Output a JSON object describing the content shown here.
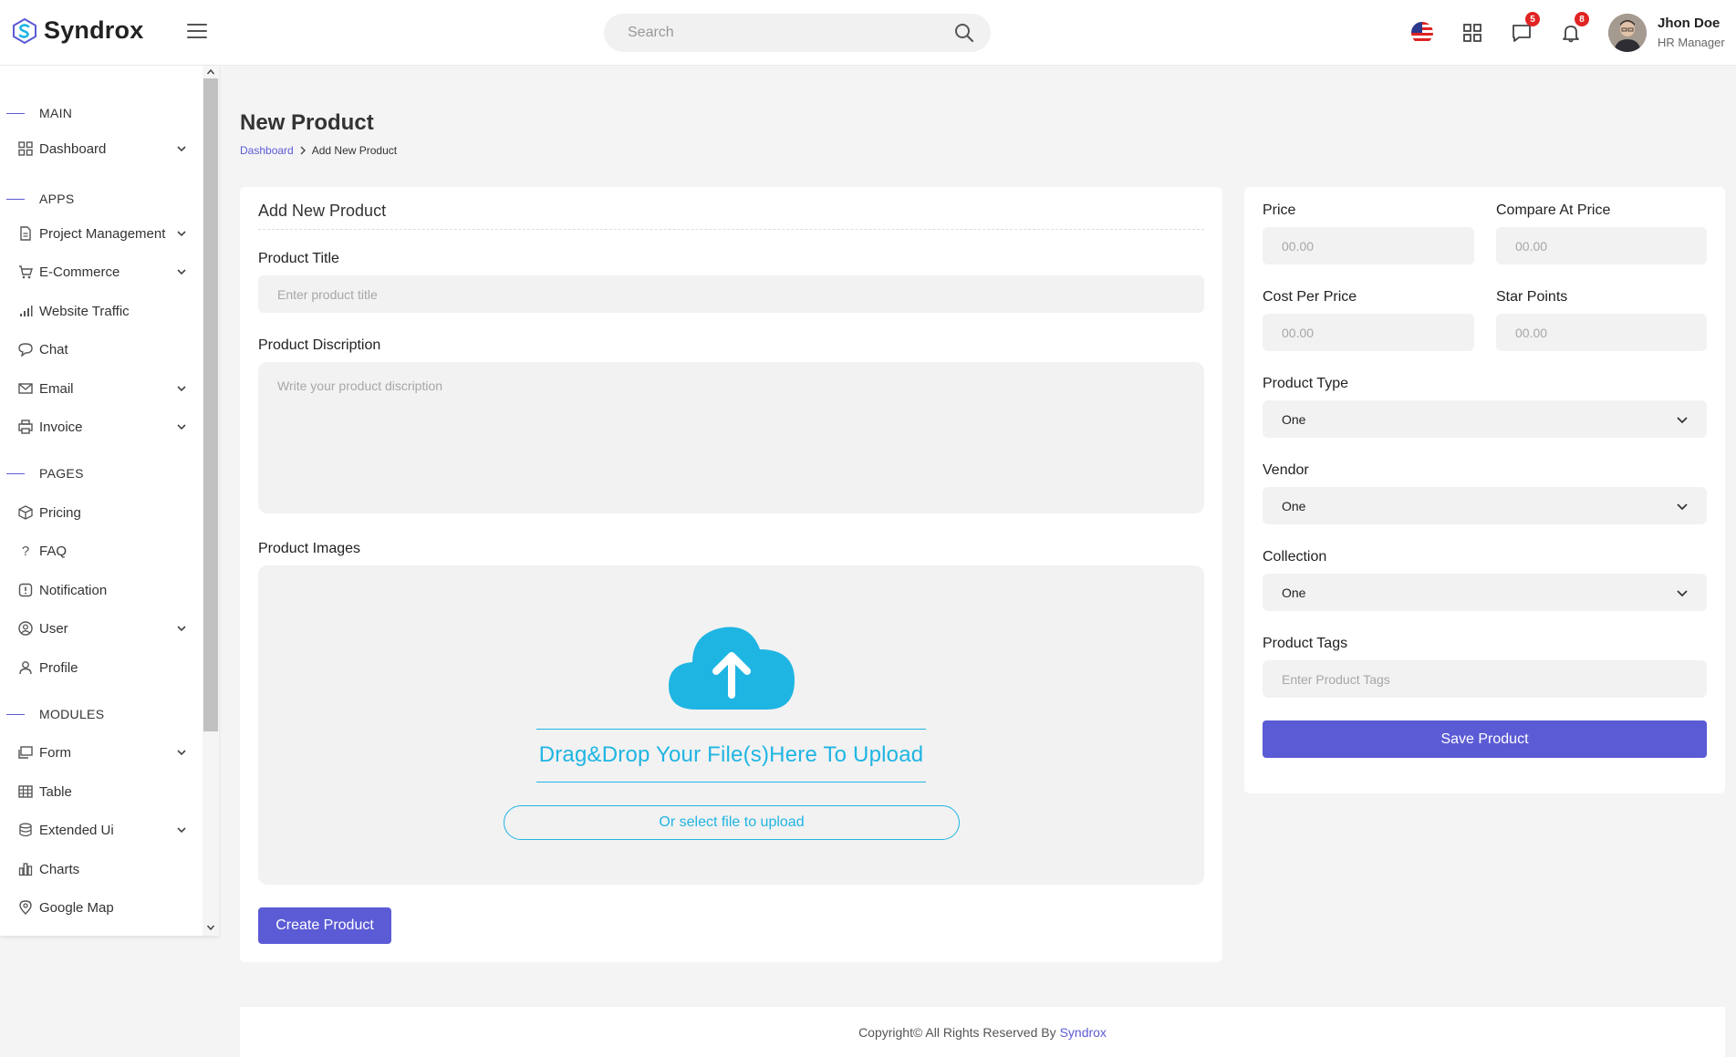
{
  "header": {
    "brand": "Syndrox",
    "search_placeholder": "Search",
    "messages_count": "5",
    "notifications_count": "8",
    "user_name": "Jhon Doe",
    "user_role": "HR Manager"
  },
  "sidebar": {
    "sections": {
      "main": "MAIN",
      "apps": "APPS",
      "pages": "PAGES",
      "modules": "MODULES"
    },
    "items": {
      "dashboard": "Dashboard",
      "project_management": "Project Management",
      "ecommerce": "E-Commerce",
      "website_traffic": "Website Traffic",
      "chat": "Chat",
      "email": "Email",
      "invoice": "Invoice",
      "pricing": "Pricing",
      "faq": "FAQ",
      "notification": "Notification",
      "user": "User",
      "profile": "Profile",
      "form": "Form",
      "table": "Table",
      "extended_ui": "Extended Ui",
      "charts": "Charts",
      "google_map": "Google Map"
    }
  },
  "page": {
    "title": "New Product",
    "breadcrumb": {
      "parent": "Dashboard",
      "current": "Add New Product"
    }
  },
  "product_form": {
    "card_title": "Add New Product",
    "title_label": "Product Title",
    "title_placeholder": "Enter product title",
    "description_label": "Product Discription",
    "description_placeholder": "Write your product discription",
    "images_label": "Product Images",
    "dropzone_text": "Drag&Drop Your File(s)Here To Upload",
    "select_file_label": "Or select file to upload",
    "create_button": "Create Product"
  },
  "pricing_form": {
    "price_label": "Price",
    "price_placeholder": "00.00",
    "compare_label": "Compare At Price",
    "compare_placeholder": "00.00",
    "cost_label": "Cost Per Price",
    "cost_placeholder": "00.00",
    "star_label": "Star Points",
    "star_placeholder": "00.00",
    "type_label": "Product Type",
    "type_value": "One",
    "vendor_label": "Vendor",
    "vendor_value": "One",
    "collection_label": "Collection",
    "collection_value": "One",
    "tags_label": "Product Tags",
    "tags_placeholder": "Enter Product Tags",
    "save_button": "Save Product"
  },
  "footer": {
    "text": "Copyright© All Rights Reserved By",
    "brand": "Syndrox"
  },
  "colors": {
    "primary": "#5b5bd6",
    "upload_accent": "#1fb5e3",
    "badge": "#e02424"
  }
}
